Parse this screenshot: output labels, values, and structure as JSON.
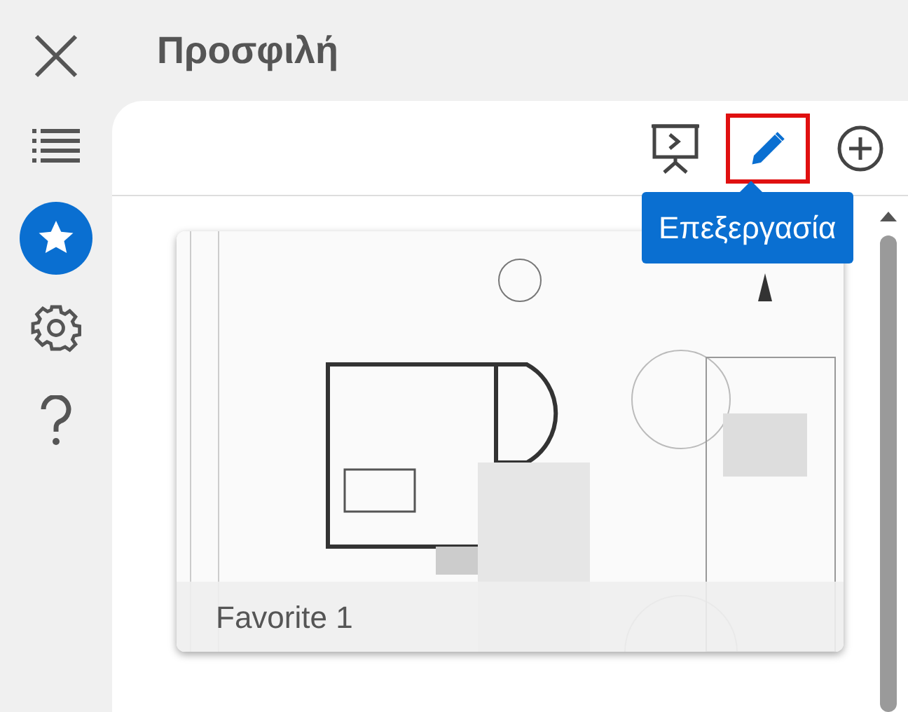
{
  "title": "Προσφιλή",
  "nav": [
    {
      "kind": "close",
      "selected": false
    },
    {
      "kind": "list",
      "selected": false
    },
    {
      "kind": "star",
      "selected": true
    },
    {
      "kind": "settings",
      "selected": false
    },
    {
      "kind": "help",
      "selected": false
    }
  ],
  "toolbar": [
    {
      "kind": "present",
      "highlighted": false
    },
    {
      "kind": "edit",
      "highlighted": true
    },
    {
      "kind": "add",
      "highlighted": false
    }
  ],
  "tooltip": "Επεξεργασία",
  "favorites": [
    {
      "name": "Favorite 1",
      "kind": "picture"
    }
  ]
}
